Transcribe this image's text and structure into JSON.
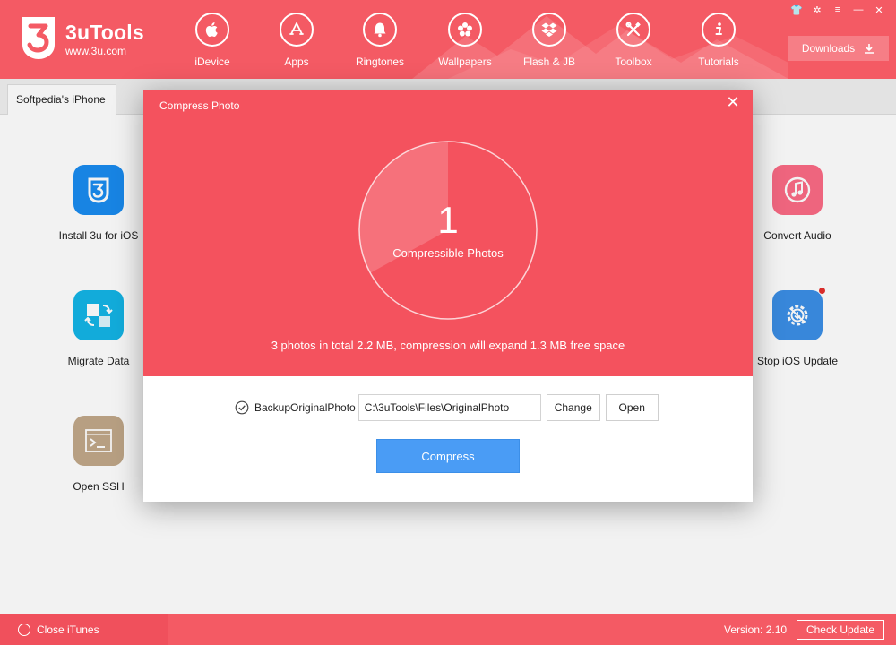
{
  "app": {
    "name": "3uTools",
    "url": "www.3u.com",
    "accent_color": "#f45a64",
    "compress_color": "#4a9cf5"
  },
  "nav": [
    {
      "label": "iDevice",
      "icon": "apple-icon"
    },
    {
      "label": "Apps",
      "icon": "app-store-icon"
    },
    {
      "label": "Ringtones",
      "icon": "bell-icon"
    },
    {
      "label": "Wallpapers",
      "icon": "flower-icon"
    },
    {
      "label": "Flash & JB",
      "icon": "dropbox-icon"
    },
    {
      "label": "Toolbox",
      "icon": "tools-icon"
    },
    {
      "label": "Tutorials",
      "icon": "info-icon"
    }
  ],
  "window_controls": [
    "skin-icon",
    "settings-icon",
    "menu-icon",
    "minimize-icon",
    "close-icon"
  ],
  "downloads": {
    "label": "Downloads",
    "icon": "download-icon"
  },
  "device_tab": {
    "label": "Softpedia's iPhone"
  },
  "tools": {
    "install": {
      "label": "Install 3u for iOS",
      "icon": "3u-icon"
    },
    "migrate": {
      "label": "Migrate Data",
      "icon": "migrate-icon"
    },
    "ssh": {
      "label": "Open SSH",
      "icon": "terminal-icon"
    },
    "audio": {
      "label": "Convert Audio",
      "icon": "music-note-icon"
    },
    "ios_update": {
      "label": "Stop iOS Update",
      "icon": "gear-icon"
    }
  },
  "dialog": {
    "title": "Compress Photo",
    "count": "1",
    "count_label": "Compressible Photos",
    "summary": "3 photos in total 2.2 MB, compression will expand 1.3 MB free space",
    "compressible_fraction": 0.33,
    "backup_label": "BackupOriginalPhoto",
    "backup_checked": true,
    "path": "C:\\3uTools\\Files\\OriginalPhoto",
    "change_label": "Change",
    "open_label": "Open",
    "compress_label": "Compress"
  },
  "footer": {
    "close_itunes": "Close iTunes",
    "version": "Version: 2.10",
    "check_update": "Check Update"
  }
}
